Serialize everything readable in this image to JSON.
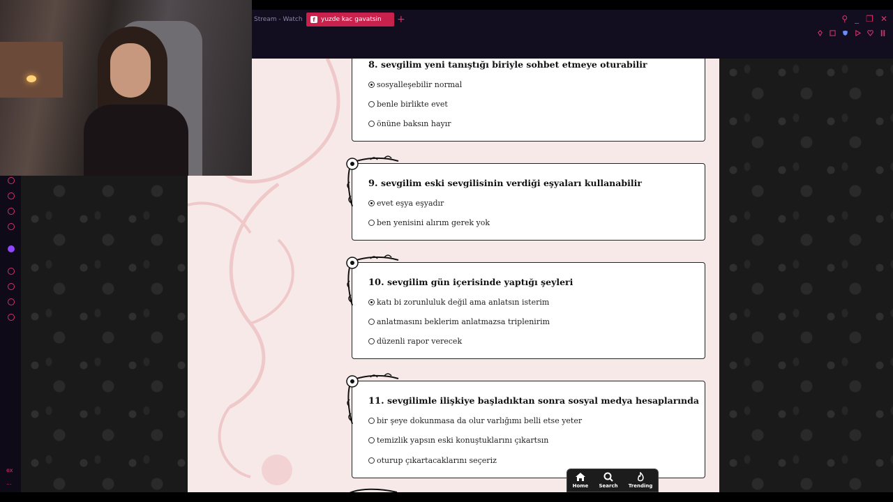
{
  "browser": {
    "tabs": [
      {
        "label": "Stream - Watch Li",
        "active": false
      },
      {
        "label": "yuzde kac gavatsin",
        "active": true
      }
    ],
    "new_tab": "+",
    "accent_color": "#c8224c"
  },
  "sidebar": {
    "bottom_text": "ex",
    "more": "..."
  },
  "quiz": {
    "questions": [
      {
        "number": "8.",
        "text": "sevgilim yeni tanıştığı biriyle sohbet etmeye oturabilir",
        "options": [
          {
            "label": "sosyalleşebilir normal",
            "selected": true
          },
          {
            "label": "benle birlikte evet",
            "selected": false
          },
          {
            "label": "önüne baksın hayır",
            "selected": false
          }
        ]
      },
      {
        "number": "9.",
        "text": "sevgilim eski sevgilisinin verdiği eşyaları kullanabilir",
        "options": [
          {
            "label": "evet eşya eşyadır",
            "selected": true
          },
          {
            "label": "ben yenisini alırım gerek yok",
            "selected": false
          }
        ]
      },
      {
        "number": "10.",
        "text": "sevgilim gün içerisinde yaptığı şeyleri",
        "options": [
          {
            "label": "katı bi zorunluluk değil ama anlatsın isterim",
            "selected": true
          },
          {
            "label": "anlatmasını beklerim anlatmazsa triplenirim",
            "selected": false
          },
          {
            "label": "düzenli rapor verecek",
            "selected": false
          }
        ]
      },
      {
        "number": "11.",
        "text": "sevgilimle ilişkiye başladıktan sonra sosyal medya hesaplarında",
        "options": [
          {
            "label": "bir şeye dokunmasa da olur varlığımı belli etse yeter",
            "selected": false
          },
          {
            "label": "temizlik yapsın eski konuştuklarını çıkartsın",
            "selected": false
          },
          {
            "label": "oturup çıkartacaklarını seçeriz",
            "selected": false
          }
        ]
      }
    ]
  },
  "bottom_nav": {
    "home": "Home",
    "search": "Search",
    "trending": "Trending"
  }
}
